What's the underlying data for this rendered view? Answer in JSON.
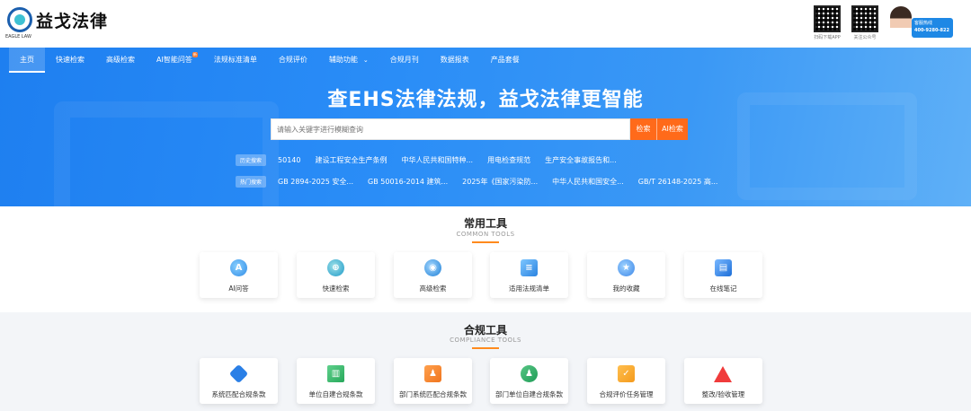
{
  "header": {
    "logo_text": "益戈法律",
    "logo_sub": "EAGLE LAW",
    "qr_codes": [
      {
        "caption": "扫码下载APP"
      },
      {
        "caption": "关注公众号"
      }
    ],
    "hotline": {
      "label": "客服热线",
      "number": "400-9280-822"
    }
  },
  "nav": {
    "items": [
      {
        "label": "主页",
        "active": true
      },
      {
        "label": "快速检索"
      },
      {
        "label": "高级检索"
      },
      {
        "label": "AI智能问答",
        "badge": "新"
      },
      {
        "label": "法规标准清单"
      },
      {
        "label": "合规评价"
      },
      {
        "label": "辅助功能",
        "dropdown": true
      },
      {
        "label": "合规月刊"
      },
      {
        "label": "数据报表"
      },
      {
        "label": "产品套餐"
      }
    ]
  },
  "hero": {
    "title": "查EHS法律法规，益戈法律更智能",
    "search": {
      "placeholder": "请输入关键字进行模糊查询",
      "value": ""
    },
    "search_button": "检索",
    "ai_button": "AI检索",
    "history_label": "历史搜索",
    "history": [
      "50140",
      "建设工程安全生产条例",
      "中华人民共和国特种...",
      "用电检查规范",
      "生产安全事故报告和..."
    ],
    "hot_label": "热门搜索",
    "hot": [
      "GB 2894-2025 安全...",
      "GB 50016-2014 建筑...",
      "2025年《国家污染防...",
      "中华人民共和国安全...",
      "GB/T 26148-2025 高..."
    ]
  },
  "common_tools": {
    "title": "常用工具",
    "subtitle": "COMMON TOOLS",
    "items": [
      {
        "label": "AI问答",
        "icon": "ai-chat-icon"
      },
      {
        "label": "快速检索",
        "icon": "quick-search-icon"
      },
      {
        "label": "高级检索",
        "icon": "advanced-search-icon"
      },
      {
        "label": "适用法规清单",
        "icon": "law-list-icon"
      },
      {
        "label": "我的收藏",
        "icon": "star-icon"
      },
      {
        "label": "在线笔记",
        "icon": "notebook-icon"
      }
    ]
  },
  "compliance_tools": {
    "title": "合规工具",
    "subtitle": "COMPLIANCE TOOLS",
    "items": [
      {
        "label": "系统匹配合规条款",
        "icon": "shield-check-icon"
      },
      {
        "label": "单位自建合规条款",
        "icon": "building-icon"
      },
      {
        "label": "部门系统匹配合规条款",
        "icon": "user-document-icon"
      },
      {
        "label": "部门单位自建合规条款",
        "icon": "team-icon"
      },
      {
        "label": "合规评价任务管理",
        "icon": "clipboard-check-icon"
      },
      {
        "label": "整改/验收管理",
        "icon": "warning-icon"
      }
    ]
  },
  "colors": {
    "brand_blue": "#2a8df7",
    "accent_orange": "#ff6a1a",
    "title_underline": "#ff8a1d"
  }
}
